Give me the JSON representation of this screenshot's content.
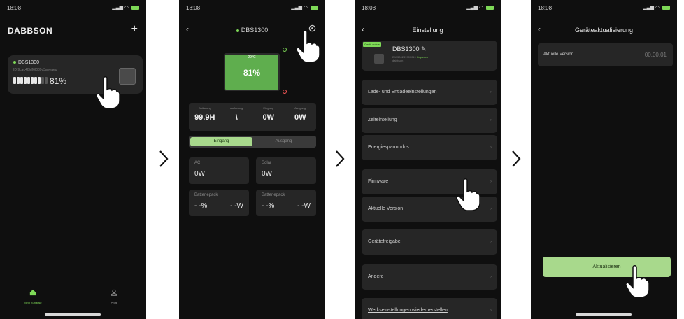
{
  "status": {
    "time": "18:08"
  },
  "panel1": {
    "brand": "DABBSON",
    "plus": "+",
    "device_name": "DBS1300",
    "device_sub": "ID:9cac4f3df6f089c3aeeaeg",
    "battery_percent": "81%",
    "battery_level": 0.81,
    "tab_home": "Mein Zuhause",
    "tab_profile": "Profil"
  },
  "panel2": {
    "back": "‹",
    "title": "DBS1300",
    "temperature": "29°C",
    "battery_percent": "81%",
    "stats": [
      {
        "label": "Entladung",
        "value": "99.9H"
      },
      {
        "label": "Aufladung",
        "value": "\\"
      },
      {
        "label": "Eingang",
        "value": "0W"
      },
      {
        "label": "Ausgang",
        "value": "0W"
      }
    ],
    "tab_in": "Eingang",
    "tab_out": "Ausgang",
    "ac_label": "AC",
    "ac_value": "0W",
    "solar_label": "Solar",
    "solar_value": "0W",
    "pack1_label": "Batteriepack",
    "pack1_pct": "- -%",
    "pack1_w": "- -W",
    "pack2_label": "Batteriepack",
    "pack2_pct": "- -%",
    "pack2_w": "- -W"
  },
  "panel3": {
    "back": "‹",
    "title": "Einstellung",
    "badge": "Gerät online",
    "device_name": "DBS1300",
    "device_sn": "D11300231900019",
    "copy": "Kopieren",
    "device_brand": "dabbson",
    "rows": [
      "Lade- und Entladeeinstellungen",
      "Zeiteinteilung",
      "Energiesparmodus",
      "Firmware",
      "Aktuelle Version",
      "Gerätefreigabe",
      "Andere",
      "Werkseinstellungen wiederherstellen"
    ],
    "chevron": "›"
  },
  "panel4": {
    "back": "‹",
    "title": "Geräteaktualisierung",
    "version_label": "Aktuelle Version",
    "version_value": "00.00.01",
    "update_button": "Aktualisieren"
  },
  "colors": {
    "accent": "#7ed957",
    "button": "#a8d98c",
    "card": "#262626",
    "bg": "#0f0f0f"
  },
  "icons": [
    "plus-icon",
    "gear-icon",
    "power-icon",
    "home-icon",
    "profile-icon",
    "edit-icon",
    "hand-pointer-icon",
    "chevron-right-icon"
  ]
}
